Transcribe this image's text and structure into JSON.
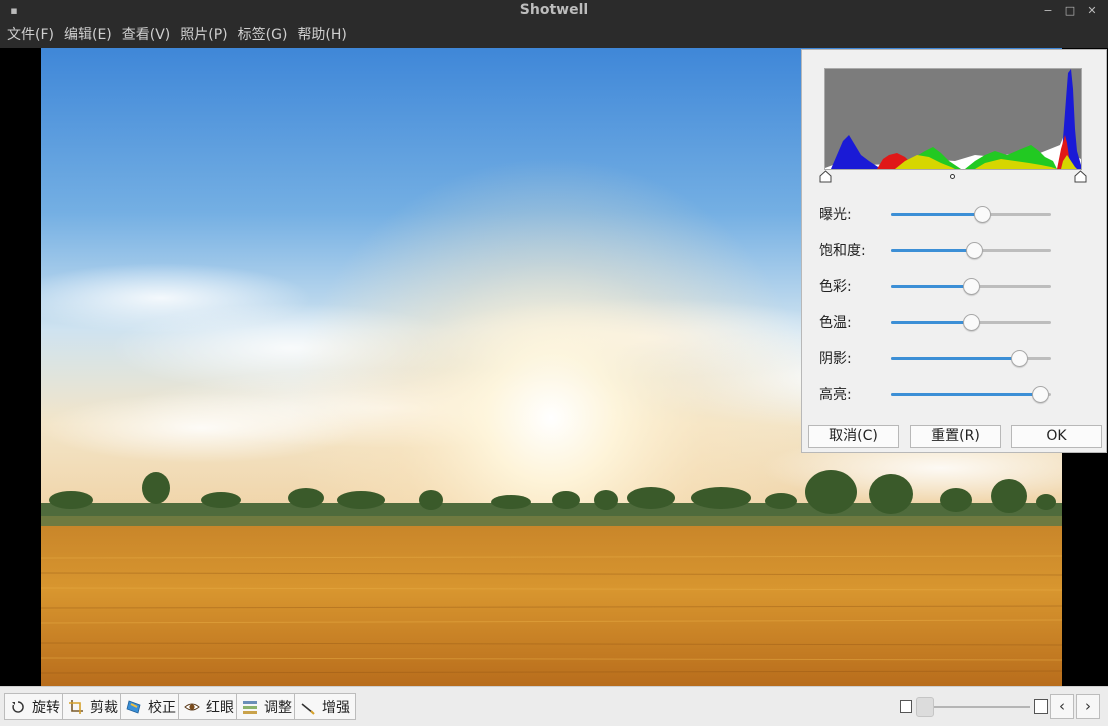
{
  "window": {
    "title": "Shotwell",
    "menu_icon": "window-menu-icon",
    "minimize_glyph": "−",
    "maximize_glyph": "□",
    "close_glyph": "✕"
  },
  "menubar": {
    "items": [
      "文件(F)",
      "编辑(E)",
      "查看(V)",
      "照片(P)",
      "标签(G)",
      "帮助(H)"
    ]
  },
  "adjust_panel": {
    "sliders": [
      {
        "label": "曝光:",
        "value": 0.57
      },
      {
        "label": "饱和度:",
        "value": 0.52
      },
      {
        "label": "色彩:",
        "value": 0.5
      },
      {
        "label": "色温:",
        "value": 0.5
      },
      {
        "label": "阴影:",
        "value": 0.8
      },
      {
        "label": "高亮:",
        "value": 0.93
      }
    ],
    "buttons": {
      "cancel": "取消(C)",
      "reset": "重置(R)",
      "ok": "OK"
    }
  },
  "toolbar": {
    "rotate": "旋转",
    "crop": "剪裁",
    "straighten": "校正",
    "redeye": "红眼",
    "adjust": "调整",
    "enhance": "增强",
    "zoom_level": 0.0,
    "prev_glyph": "‹",
    "next_glyph": "›"
  },
  "colors": {
    "titlebar": "#2b2b2b",
    "accent": "#3c8fd6",
    "histogram_blue": "#1a1ad6",
    "histogram_green": "#22c922",
    "histogram_red": "#e01818",
    "histogram_yellow": "#d6d600"
  }
}
